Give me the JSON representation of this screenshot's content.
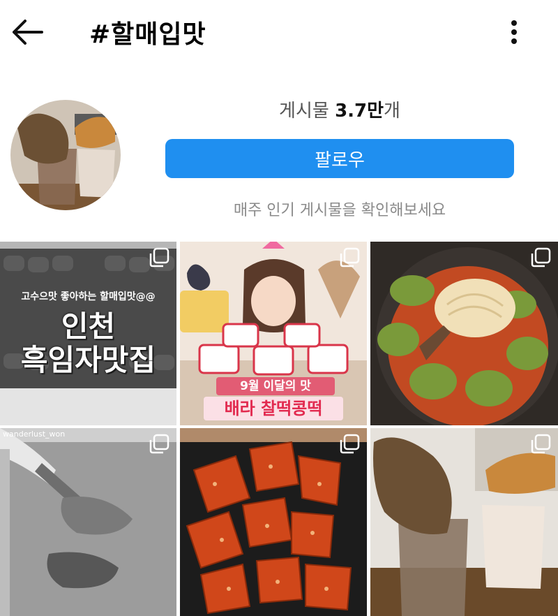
{
  "header": {
    "title": "#할매입맛"
  },
  "profile": {
    "posts_label": "게시물",
    "posts_count": "3.7만",
    "posts_suffix": "개",
    "follow_label": "팔로우",
    "weekly_text": "매주 인기 게시물을 확인해보세요"
  },
  "posts": [
    {
      "lines": [
        "고수으맛 좋아하는 할매입맛@@",
        "인천",
        "흑임자맛집"
      ]
    },
    {
      "lines": [
        "9월 이달의 맛",
        "배라 찰떡콩떡"
      ]
    },
    {
      "lines": []
    },
    {
      "lines": [
        "wanderlust_won"
      ]
    },
    {
      "lines": []
    },
    {
      "lines": []
    }
  ],
  "colors": {
    "accent": "#1f8ff0",
    "muted": "#8a8a8a"
  }
}
